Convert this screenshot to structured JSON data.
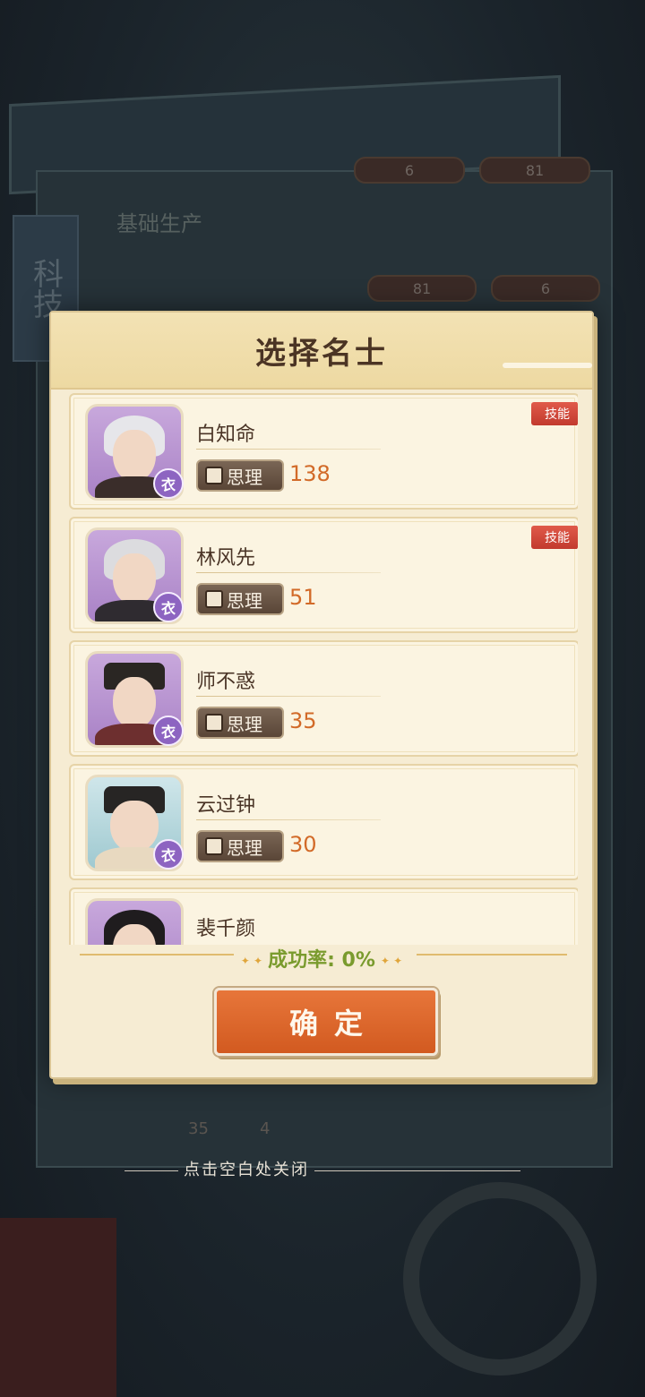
{
  "background": {
    "side_tab_label": "科技",
    "section_label": "基础生产",
    "resource_pills": [
      "6",
      "81",
      "81",
      "6"
    ],
    "bottom_stats": [
      "35",
      "4"
    ]
  },
  "popup": {
    "title": "选择名士",
    "success_label": "成功率: 0%",
    "confirm_label": "确定"
  },
  "scholars": [
    {
      "name": "白知命",
      "stat_label": "思理",
      "stat_value": "138",
      "has_skill": true,
      "badge": "衣",
      "portrait_bg": "purple"
    },
    {
      "name": "林风先",
      "stat_label": "思理",
      "stat_value": "51",
      "has_skill": true,
      "badge": "衣",
      "portrait_bg": "purple"
    },
    {
      "name": "师不惑",
      "stat_label": "思理",
      "stat_value": "35",
      "has_skill": false,
      "badge": "衣",
      "portrait_bg": "purple"
    },
    {
      "name": "云过钟",
      "stat_label": "思理",
      "stat_value": "30",
      "has_skill": false,
      "badge": "衣",
      "portrait_bg": "blue"
    },
    {
      "name": "裴千颜",
      "stat_label": "",
      "stat_value": "",
      "has_skill": false,
      "badge": "",
      "portrait_bg": "purple"
    }
  ],
  "skill_tag_label": "技能",
  "close_hint": "点击空白处关闭",
  "colors": {
    "accent_orange": "#d25a20",
    "stat_value": "#d26a28",
    "success_green": "#7a9b2e",
    "skill_red": "#c23a2e",
    "badge_purple": "#8d64c1"
  }
}
